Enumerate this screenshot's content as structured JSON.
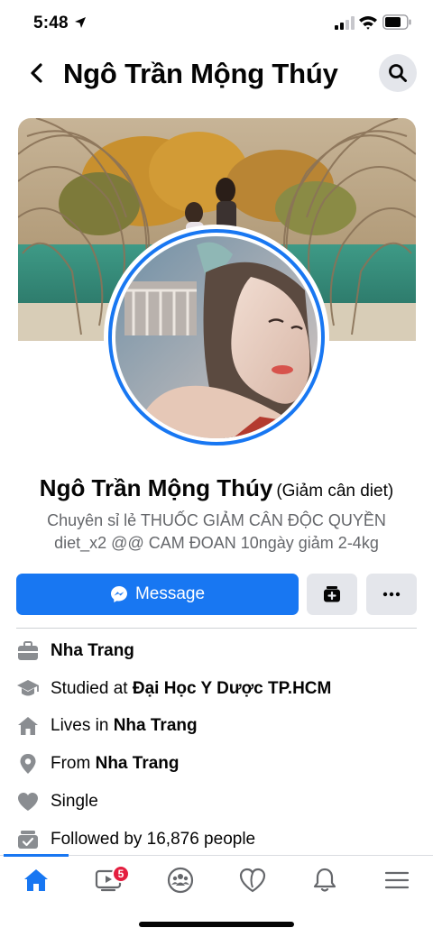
{
  "status_bar": {
    "time": "5:48"
  },
  "header": {
    "title": "Ngô Trần Mộng Thúy",
    "icons": {
      "back": "chevron-left-icon",
      "search": "search-icon"
    }
  },
  "profile": {
    "name": "Ngô Trần Mộng Thúy",
    "alternate_name": "(Giảm cân diet)",
    "bio": "Chuyên sỉ lẻ THUỐC GIẢM CÂN ĐỘC QUYỀN diet_x2 @@ CAM ĐOAN   10ngày giảm 2-4kg"
  },
  "actions": {
    "message_label": "Message",
    "icons": {
      "message": "messenger-icon",
      "story": "story-add-icon",
      "more": "more-dots-icon"
    }
  },
  "details": {
    "work": {
      "text": "Nha Trang",
      "icon": "briefcase-icon"
    },
    "education": {
      "prefix": "Studied at ",
      "value": "Đại Học Y Dược TP.HCM",
      "icon": "graduation-cap-icon"
    },
    "lives": {
      "prefix": "Lives in ",
      "value": "Nha Trang",
      "icon": "home-icon"
    },
    "from": {
      "prefix": "From ",
      "value": "Nha Trang",
      "icon": "location-pin-icon"
    },
    "relationship": {
      "text": "Single",
      "icon": "heart-icon"
    },
    "followers": {
      "text": "Followed by 16,876 people",
      "icon": "followers-icon"
    }
  },
  "tab_bar": {
    "watch_badge": "5",
    "tabs": [
      "home-icon",
      "watch-icon",
      "groups-icon",
      "dating-icon",
      "notifications-icon",
      "menu-icon"
    ],
    "active": "home"
  },
  "colors": {
    "accent": "#1877f2",
    "secondary_text": "#65676b",
    "icon_gray": "#8a8d91",
    "badge": "#e41e3f",
    "button_gray": "#e4e6eb"
  }
}
